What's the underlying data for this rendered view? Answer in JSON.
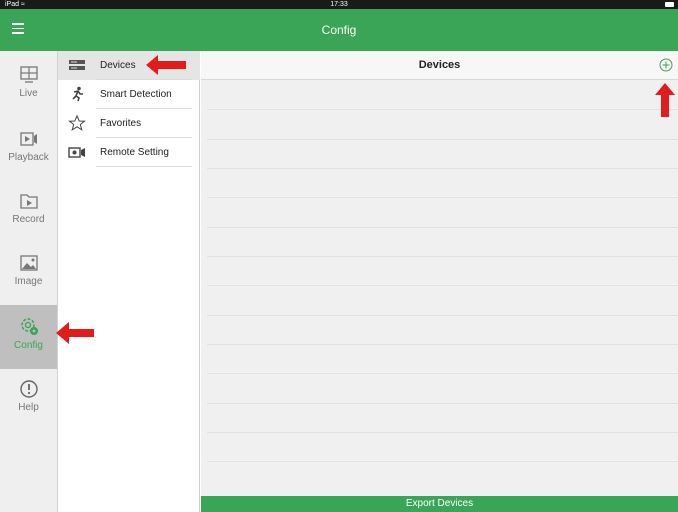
{
  "status_bar": {
    "device": "iPad",
    "time": "17:33"
  },
  "nav": {
    "title": "Config"
  },
  "rail": [
    {
      "label": "Live"
    },
    {
      "label": "Playback"
    },
    {
      "label": "Record"
    },
    {
      "label": "Image"
    },
    {
      "label": "Config"
    },
    {
      "label": "Help"
    }
  ],
  "menu": [
    {
      "label": "Devices"
    },
    {
      "label": "Smart Detection"
    },
    {
      "label": "Favorites"
    },
    {
      "label": "Remote Setting"
    }
  ],
  "main": {
    "title": "Devices",
    "export_label": "Export Devices"
  },
  "colors": {
    "accent": "#3aa556",
    "annotation": "#e21b1b"
  }
}
